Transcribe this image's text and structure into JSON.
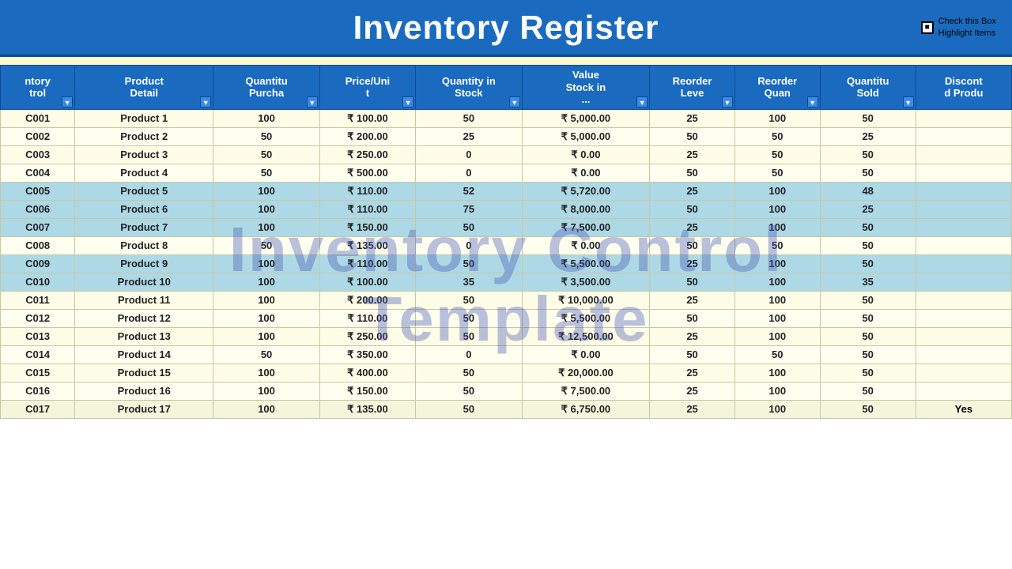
{
  "header": {
    "title": "Inventory Register",
    "checkbox_label": "Check this Box\nHighlight Items"
  },
  "watermark": {
    "line1": "Inventory Control",
    "line2": "Template"
  },
  "columns": [
    {
      "key": "inventory_control",
      "label": "Inventory Control",
      "short": "ntory\ntrol"
    },
    {
      "key": "product_detail",
      "label": "Product Detail"
    },
    {
      "key": "qty_purchased",
      "label": "Quantity Purchased",
      "short": "Quantitu\nPurcha"
    },
    {
      "key": "price_unit",
      "label": "Price/Unit",
      "short": "Price/Uni\nt"
    },
    {
      "key": "qty_in_stock",
      "label": "Quantity in Stock",
      "short": "Quantity in\nStock"
    },
    {
      "key": "value_stock",
      "label": "Value Stock in ...",
      "short": "Value\nStock in\n..."
    },
    {
      "key": "reorder_level",
      "label": "Reorder Level",
      "short": "Reorder\nLeve"
    },
    {
      "key": "reorder_qty",
      "label": "Reorder Quantity",
      "short": "Reorder\nQuan"
    },
    {
      "key": "qty_sold",
      "label": "Quantity Sold",
      "short": "Quantitu\nSold"
    },
    {
      "key": "discontinued",
      "label": "Discontinued Product",
      "short": "Discont\nd Produ"
    }
  ],
  "rows": [
    {
      "inventory_control": "C001",
      "product_detail": "Product 1",
      "qty_purchased": "100",
      "price_unit": "₹ 100.00",
      "qty_in_stock": "50",
      "value_stock": "₹ 5,000.00",
      "reorder_level": "25",
      "reorder_qty": "100",
      "qty_sold": "50",
      "discontinued": "",
      "highlight": false
    },
    {
      "inventory_control": "C002",
      "product_detail": "Product 2",
      "qty_purchased": "50",
      "price_unit": "₹ 200.00",
      "qty_in_stock": "25",
      "value_stock": "₹ 5,000.00",
      "reorder_level": "50",
      "reorder_qty": "50",
      "qty_sold": "25",
      "discontinued": "",
      "highlight": false
    },
    {
      "inventory_control": "C003",
      "product_detail": "Product 3",
      "qty_purchased": "50",
      "price_unit": "₹ 250.00",
      "qty_in_stock": "0",
      "value_stock": "₹ 0.00",
      "reorder_level": "25",
      "reorder_qty": "50",
      "qty_sold": "50",
      "discontinued": "",
      "highlight": false
    },
    {
      "inventory_control": "C004",
      "product_detail": "Product 4",
      "qty_purchased": "50",
      "price_unit": "₹ 500.00",
      "qty_in_stock": "0",
      "value_stock": "₹ 0.00",
      "reorder_level": "50",
      "reorder_qty": "50",
      "qty_sold": "50",
      "discontinued": "",
      "highlight": false
    },
    {
      "inventory_control": "C005",
      "product_detail": "Product 5",
      "qty_purchased": "100",
      "price_unit": "₹ 110.00",
      "qty_in_stock": "52",
      "value_stock": "₹ 5,720.00",
      "reorder_level": "25",
      "reorder_qty": "100",
      "qty_sold": "48",
      "discontinued": "",
      "highlight": true
    },
    {
      "inventory_control": "C006",
      "product_detail": "Product 6",
      "qty_purchased": "100",
      "price_unit": "₹ 110.00",
      "qty_in_stock": "75",
      "value_stock": "₹ 8,000.00",
      "reorder_level": "50",
      "reorder_qty": "100",
      "qty_sold": "25",
      "discontinued": "",
      "highlight": true
    },
    {
      "inventory_control": "C007",
      "product_detail": "Product 7",
      "qty_purchased": "100",
      "price_unit": "₹ 150.00",
      "qty_in_stock": "50",
      "value_stock": "₹ 7,500.00",
      "reorder_level": "25",
      "reorder_qty": "100",
      "qty_sold": "50",
      "discontinued": "",
      "highlight": true
    },
    {
      "inventory_control": "C008",
      "product_detail": "Product 8",
      "qty_purchased": "50",
      "price_unit": "₹ 135.00",
      "qty_in_stock": "0",
      "value_stock": "₹ 0.00",
      "reorder_level": "50",
      "reorder_qty": "50",
      "qty_sold": "50",
      "discontinued": "",
      "highlight": false
    },
    {
      "inventory_control": "C009",
      "product_detail": "Product 9",
      "qty_purchased": "100",
      "price_unit": "₹ 110.00",
      "qty_in_stock": "50",
      "value_stock": "₹ 5,500.00",
      "reorder_level": "25",
      "reorder_qty": "100",
      "qty_sold": "50",
      "discontinued": "",
      "highlight": true
    },
    {
      "inventory_control": "C010",
      "product_detail": "Product 10",
      "qty_purchased": "100",
      "price_unit": "₹ 100.00",
      "qty_in_stock": "35",
      "value_stock": "₹ 3,500.00",
      "reorder_level": "50",
      "reorder_qty": "100",
      "qty_sold": "35",
      "discontinued": "",
      "highlight": true
    },
    {
      "inventory_control": "C011",
      "product_detail": "Product 11",
      "qty_purchased": "100",
      "price_unit": "₹ 200.00",
      "qty_in_stock": "50",
      "value_stock": "₹ 10,000.00",
      "reorder_level": "25",
      "reorder_qty": "100",
      "qty_sold": "50",
      "discontinued": "",
      "highlight": false
    },
    {
      "inventory_control": "C012",
      "product_detail": "Product 12",
      "qty_purchased": "100",
      "price_unit": "₹ 110.00",
      "qty_in_stock": "50",
      "value_stock": "₹ 5,500.00",
      "reorder_level": "50",
      "reorder_qty": "100",
      "qty_sold": "50",
      "discontinued": "",
      "highlight": false
    },
    {
      "inventory_control": "C013",
      "product_detail": "Product 13",
      "qty_purchased": "100",
      "price_unit": "₹ 250.00",
      "qty_in_stock": "50",
      "value_stock": "₹ 12,500.00",
      "reorder_level": "25",
      "reorder_qty": "100",
      "qty_sold": "50",
      "discontinued": "",
      "highlight": false
    },
    {
      "inventory_control": "C014",
      "product_detail": "Product 14",
      "qty_purchased": "50",
      "price_unit": "₹ 350.00",
      "qty_in_stock": "0",
      "value_stock": "₹ 0.00",
      "reorder_level": "50",
      "reorder_qty": "50",
      "qty_sold": "50",
      "discontinued": "",
      "highlight": false
    },
    {
      "inventory_control": "C015",
      "product_detail": "Product 15",
      "qty_purchased": "100",
      "price_unit": "₹ 400.00",
      "qty_in_stock": "50",
      "value_stock": "₹ 20,000.00",
      "reorder_level": "25",
      "reorder_qty": "100",
      "qty_sold": "50",
      "discontinued": "",
      "highlight": false
    },
    {
      "inventory_control": "C016",
      "product_detail": "Product 16",
      "qty_purchased": "100",
      "price_unit": "₹ 150.00",
      "qty_in_stock": "50",
      "value_stock": "₹ 7,500.00",
      "reorder_level": "25",
      "reorder_qty": "100",
      "qty_sold": "50",
      "discontinued": "",
      "highlight": false
    },
    {
      "inventory_control": "C017",
      "product_detail": "Product 17",
      "qty_purchased": "100",
      "price_unit": "₹ 135.00",
      "qty_in_stock": "50",
      "value_stock": "₹ 6,750.00",
      "reorder_level": "25",
      "reorder_qty": "100",
      "qty_sold": "50",
      "discontinued": "Yes",
      "highlight": false,
      "dimmed": true
    }
  ]
}
